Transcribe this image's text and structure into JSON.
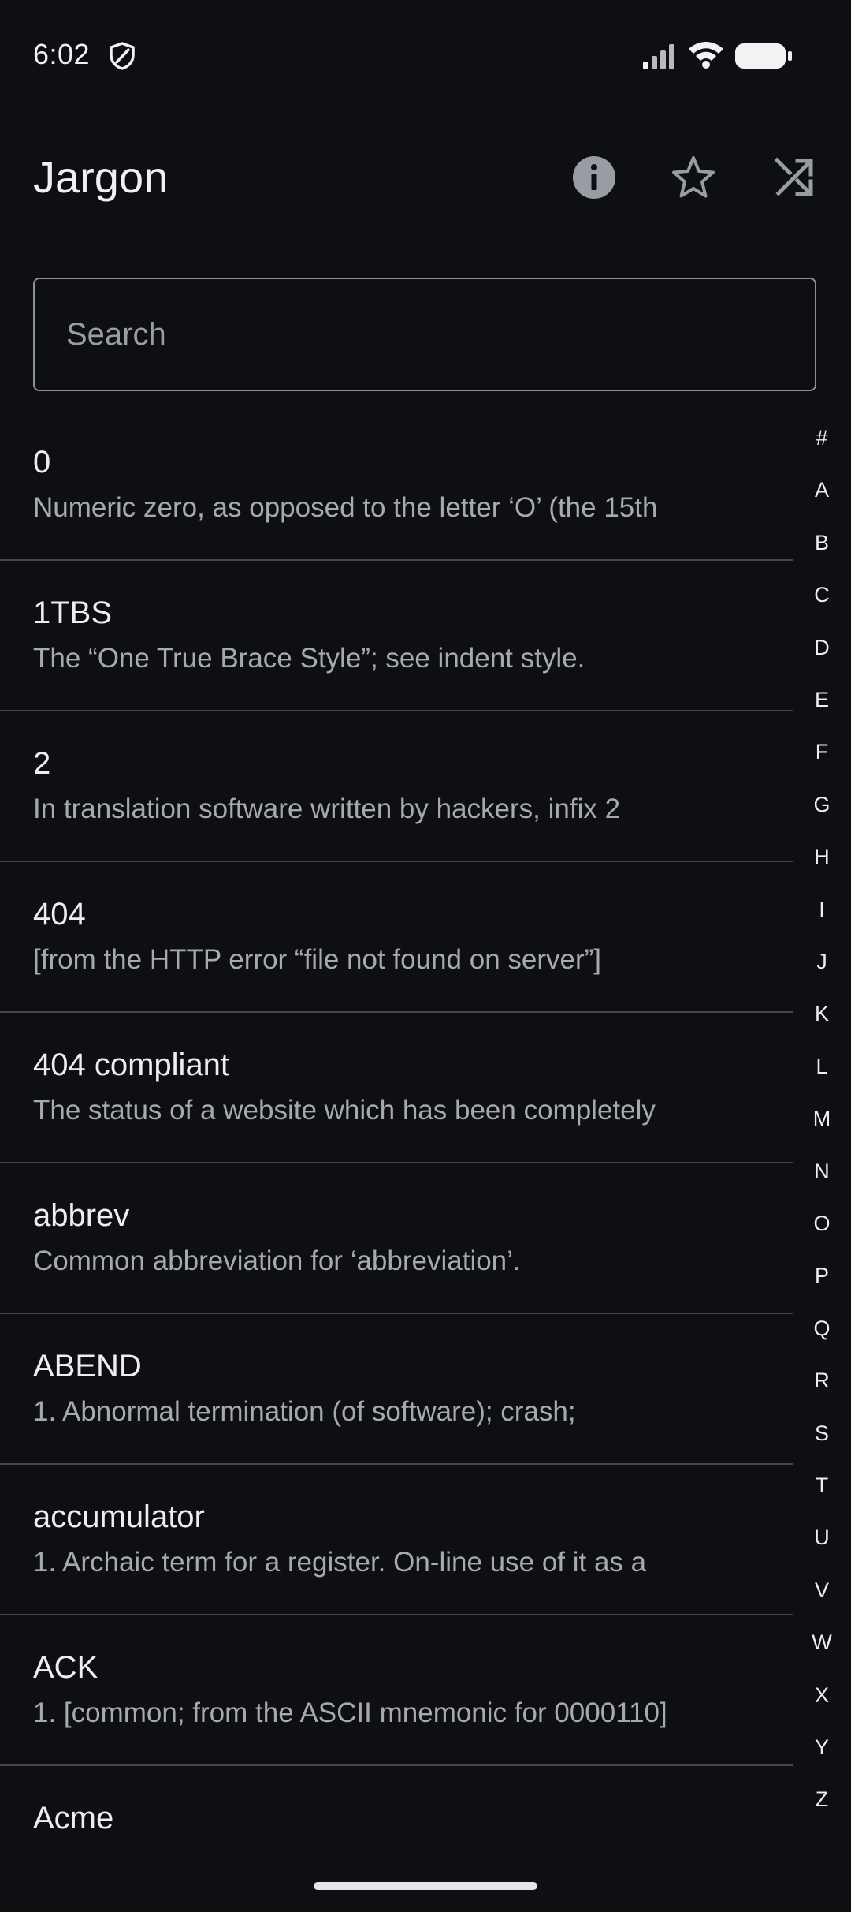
{
  "status_bar": {
    "time": "6:02",
    "icons": [
      "shield-icon",
      "signal-icon",
      "wifi-icon",
      "battery-icon"
    ]
  },
  "app_bar": {
    "title": "Jargon",
    "actions": [
      "info-icon",
      "star-icon",
      "shuffle-icon"
    ]
  },
  "search": {
    "placeholder": "Search",
    "value": ""
  },
  "entries": [
    {
      "term": "0",
      "definition": "Numeric zero, as opposed to the letter ‘O’ (the 15th"
    },
    {
      "term": "1TBS",
      "definition": "The “One True Brace Style”; see indent style."
    },
    {
      "term": "2",
      "definition": "In translation software written by hackers, infix 2"
    },
    {
      "term": "404",
      "definition": "[from the HTTP error “file not found on server”]"
    },
    {
      "term": "404 compliant",
      "definition": "The status of a website which has been completely"
    },
    {
      "term": "abbrev",
      "definition": "Common abbreviation for ‘abbreviation’."
    },
    {
      "term": "ABEND",
      "definition": "1. Abnormal termination (of software); crash;"
    },
    {
      "term": "accumulator",
      "definition": "1. Archaic term for a register. On-line use of it as a"
    },
    {
      "term": "ACK",
      "definition": "1. [common; from the ASCII mnemonic for 0000110]"
    },
    {
      "term": "Acme",
      "definition": ""
    }
  ],
  "alphabet_index": [
    "#",
    "A",
    "B",
    "C",
    "D",
    "E",
    "F",
    "G",
    "H",
    "I",
    "J",
    "K",
    "L",
    "M",
    "N",
    "O",
    "P",
    "Q",
    "R",
    "S",
    "T",
    "U",
    "V",
    "W",
    "X",
    "Y",
    "Z"
  ],
  "colors": {
    "background": "#0e0f13",
    "text_primary": "#eeeef2",
    "text_secondary": "#a7a9b0",
    "divider": "#45474d",
    "search_border": "#8d8f96"
  }
}
